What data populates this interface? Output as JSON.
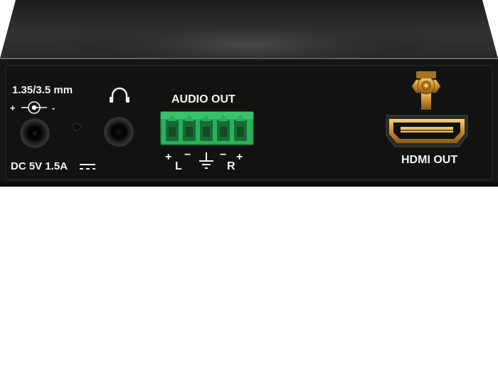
{
  "power": {
    "plug_size": "1.35/3.5 mm",
    "polarity_plus": "+",
    "polarity_minus": "-",
    "rating": "DC 5V 1.5A"
  },
  "audio": {
    "label": "AUDIO OUT",
    "pins": {
      "left_plus": "+",
      "left": "L",
      "left_minus": "−",
      "right_minus": "−",
      "right": "R",
      "right_plus": "+"
    }
  },
  "hdmi": {
    "label": "HDMI OUT"
  },
  "icons": [
    "polarity-symbol-icon",
    "headphone-icon",
    "ground-icon",
    "dc-symbol-icon",
    "hdmi-port-icon",
    "sma-antenna-connector-icon"
  ],
  "colors": {
    "chassis": "#141414",
    "terminal_block": "#2bb05a",
    "text": "#f2f2f2",
    "gold": "#d9a640"
  }
}
